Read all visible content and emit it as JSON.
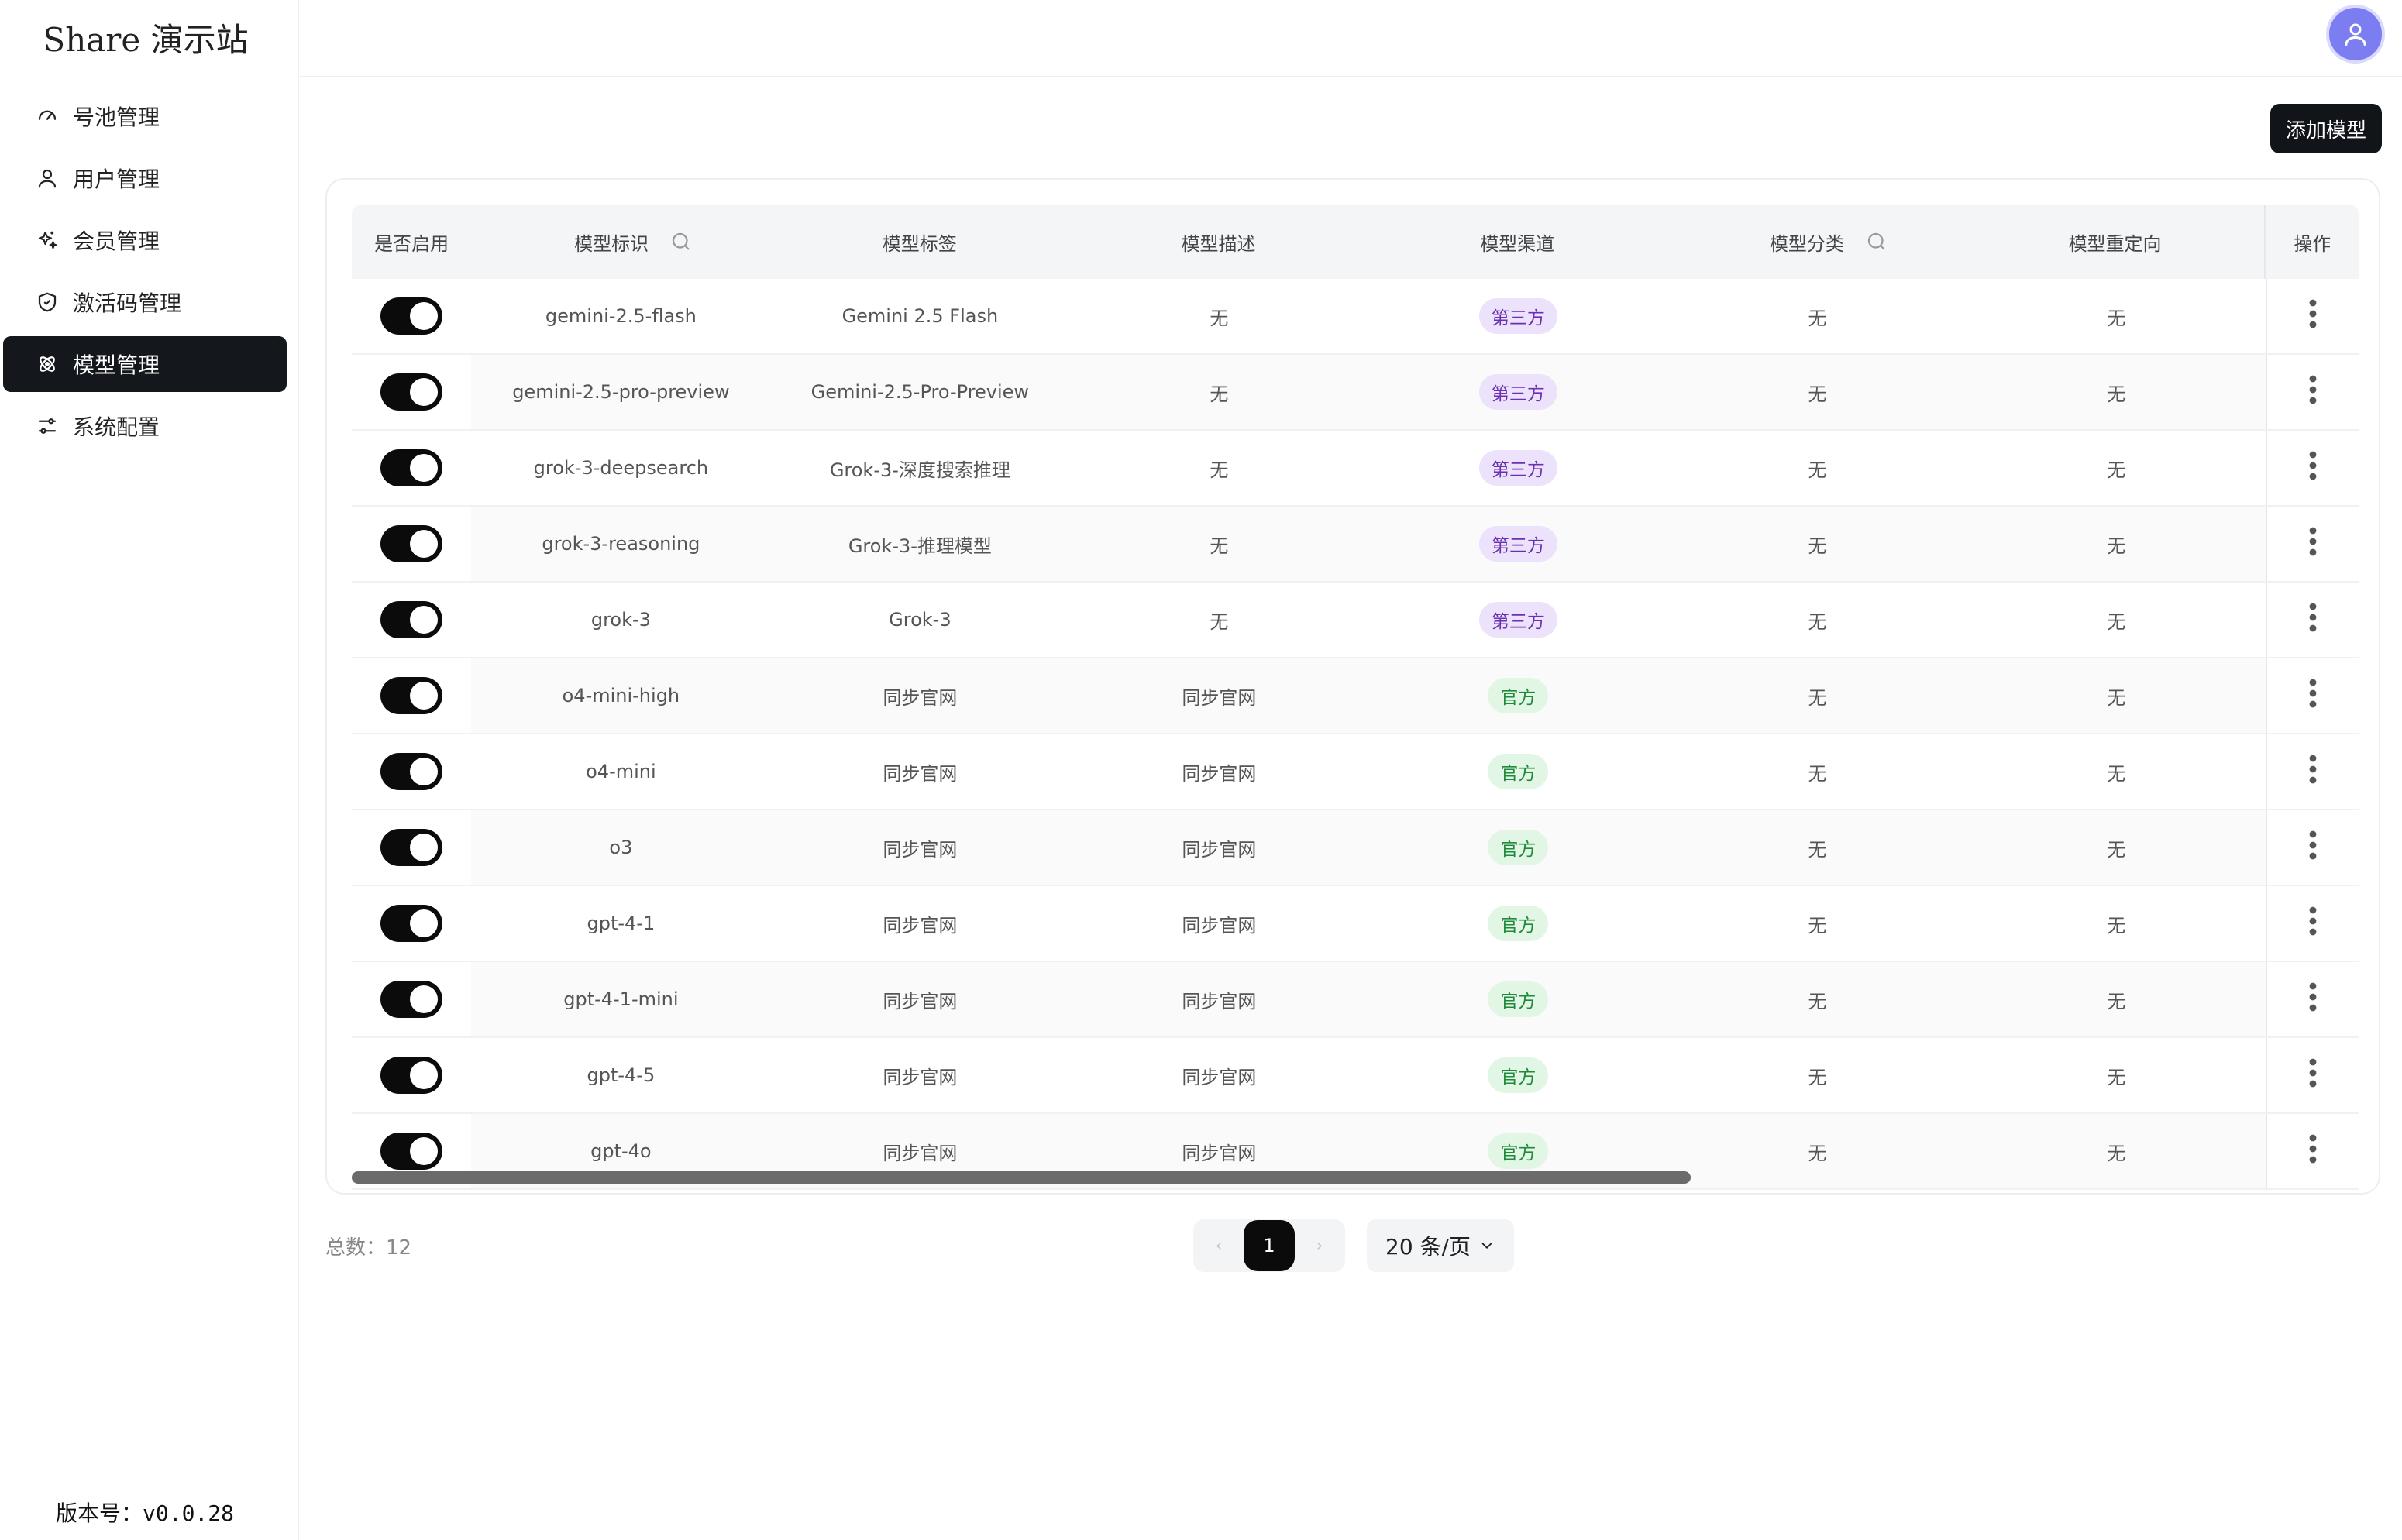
{
  "app": {
    "title": "Share 演示站",
    "version": "版本号：v0.0.28"
  },
  "sidebar": {
    "items": [
      {
        "label": "号池管理",
        "icon": "gauge-icon",
        "active": false
      },
      {
        "label": "用户管理",
        "icon": "user-icon",
        "active": false
      },
      {
        "label": "会员管理",
        "icon": "sparkles-icon",
        "active": false
      },
      {
        "label": "激活码管理",
        "icon": "shield-icon",
        "active": false
      },
      {
        "label": "模型管理",
        "icon": "atom-icon",
        "active": true
      },
      {
        "label": "系统配置",
        "icon": "sliders-icon",
        "active": false
      }
    ]
  },
  "toolbar": {
    "add_label": "添加模型"
  },
  "table": {
    "headers": {
      "enabled": "是否启用",
      "id": "模型标识",
      "label": "模型标签",
      "desc": "模型描述",
      "channel": "模型渠道",
      "category": "模型分类",
      "redirect": "模型重定向",
      "actions": "操作"
    },
    "rows": [
      {
        "enabled": true,
        "id": "gemini-2.5-flash",
        "label": "Gemini 2.5 Flash",
        "desc": "无",
        "channel": "第三方",
        "channel_type": "third",
        "category": "无",
        "redirect": "无"
      },
      {
        "enabled": true,
        "id": "gemini-2.5-pro-preview",
        "label": "Gemini-2.5-Pro-Preview",
        "desc": "无",
        "channel": "第三方",
        "channel_type": "third",
        "category": "无",
        "redirect": "无"
      },
      {
        "enabled": true,
        "id": "grok-3-deepsearch",
        "label": "Grok-3-深度搜索推理",
        "desc": "无",
        "channel": "第三方",
        "channel_type": "third",
        "category": "无",
        "redirect": "无"
      },
      {
        "enabled": true,
        "id": "grok-3-reasoning",
        "label": "Grok-3-推理模型",
        "desc": "无",
        "channel": "第三方",
        "channel_type": "third",
        "category": "无",
        "redirect": "无"
      },
      {
        "enabled": true,
        "id": "grok-3",
        "label": "Grok-3",
        "desc": "无",
        "channel": "第三方",
        "channel_type": "third",
        "category": "无",
        "redirect": "无"
      },
      {
        "enabled": true,
        "id": "o4-mini-high",
        "label": "同步官网",
        "desc": "同步官网",
        "channel": "官方",
        "channel_type": "official",
        "category": "无",
        "redirect": "无"
      },
      {
        "enabled": true,
        "id": "o4-mini",
        "label": "同步官网",
        "desc": "同步官网",
        "channel": "官方",
        "channel_type": "official",
        "category": "无",
        "redirect": "无"
      },
      {
        "enabled": true,
        "id": "o3",
        "label": "同步官网",
        "desc": "同步官网",
        "channel": "官方",
        "channel_type": "official",
        "category": "无",
        "redirect": "无"
      },
      {
        "enabled": true,
        "id": "gpt-4-1",
        "label": "同步官网",
        "desc": "同步官网",
        "channel": "官方",
        "channel_type": "official",
        "category": "无",
        "redirect": "无"
      },
      {
        "enabled": true,
        "id": "gpt-4-1-mini",
        "label": "同步官网",
        "desc": "同步官网",
        "channel": "官方",
        "channel_type": "official",
        "category": "无",
        "redirect": "无"
      },
      {
        "enabled": true,
        "id": "gpt-4-5",
        "label": "同步官网",
        "desc": "同步官网",
        "channel": "官方",
        "channel_type": "official",
        "category": "无",
        "redirect": "无"
      },
      {
        "enabled": true,
        "id": "gpt-4o",
        "label": "同步官网",
        "desc": "同步官网",
        "channel": "官方",
        "channel_type": "official",
        "category": "无",
        "redirect": "无"
      }
    ]
  },
  "pagination": {
    "total": "总数：12",
    "current_page": "1",
    "page_size": "20 条/页"
  },
  "colors": {
    "accent": "#14181d",
    "third_badge_bg": "#ede2fb",
    "official_badge_bg": "#e2f6e6",
    "avatar": "#7c7df0"
  }
}
